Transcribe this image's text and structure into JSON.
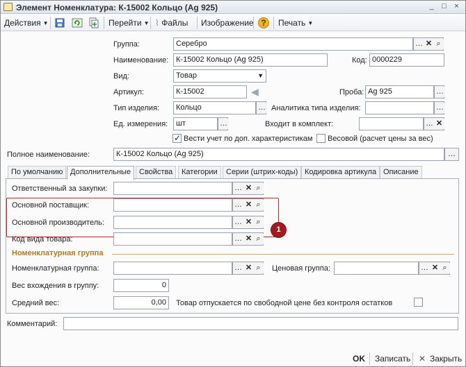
{
  "window": {
    "title": "Элемент Номенклатура: К-15002 Кольцо (Ag 925)",
    "min_label": "_",
    "max_label": "□",
    "close_label": "×"
  },
  "toolbar": {
    "actions": "Действия",
    "goto": "Перейти",
    "files": "Файлы",
    "image": "Изображение",
    "help": "?",
    "print": "Печать"
  },
  "form": {
    "group_label": "Группа:",
    "group_value": "Серебро",
    "name_label": "Наименование:",
    "name_value": "К-15002 Кольцо (Ag 925)",
    "code_label": "Код:",
    "code_value": "0000229",
    "kind_label": "Вид:",
    "kind_value": "Товар",
    "article_label": "Артикул:",
    "article_value": "К-15002",
    "sample_label": "Проба:",
    "sample_value": "Ag 925",
    "item_type_label": "Тип изделия:",
    "item_type_value": "Кольцо",
    "analytics_label": "Аналитика типа изделия:",
    "analytics_value": "",
    "unit_label": "Ед. измерения:",
    "unit_value": "шт",
    "kit_label": "Входит в комплект:",
    "kit_value": "",
    "extra_char_label": "Вести учет по доп. характеристикам",
    "extra_char_checked": true,
    "weight_label": "Весовой (расчет цены за вес)",
    "weight_checked": false,
    "fullname_label": "Полное наименование:",
    "fullname_value": "К-15002 Кольцо (Ag 925)"
  },
  "tabs": [
    "По умолчанию",
    "Дополнительные",
    "Свойства",
    "Категории",
    "Серии (штрих-коды)",
    "Кодировка артикула",
    "Описание"
  ],
  "active_tab": 1,
  "additional": {
    "purchaser_label": "Ответственный за закупки:",
    "purchaser_value": "",
    "supplier_label": "Основной поставщик:",
    "supplier_value": "",
    "manufacturer_label": "Основной производитель:",
    "manufacturer_value": "",
    "goods_code_label": "Код вида товара:",
    "goods_code_value": "",
    "nomen_group_title": "Номенклатурная группа",
    "nomen_group_label": "Номенклатурная группа:",
    "nomen_group_value": "",
    "price_group_label": "Ценовая группа:",
    "price_group_value": "",
    "weight_in_group_label": "Вес вхождения в группу:",
    "weight_in_group_value": "0",
    "avg_weight_label": "Средний вес:",
    "avg_weight_value": "0,00",
    "free_price_label": "Товар отпускается по свободной цене без контроля остатков",
    "free_price_checked": false
  },
  "comment_label": "Комментарий:",
  "comment_value": "",
  "callout_number": "1",
  "buttons": {
    "ok": "OK",
    "save": "Записать",
    "close": "Закрыть"
  },
  "colors": {
    "callout": "#a11b21",
    "section": "#b47a1e"
  }
}
